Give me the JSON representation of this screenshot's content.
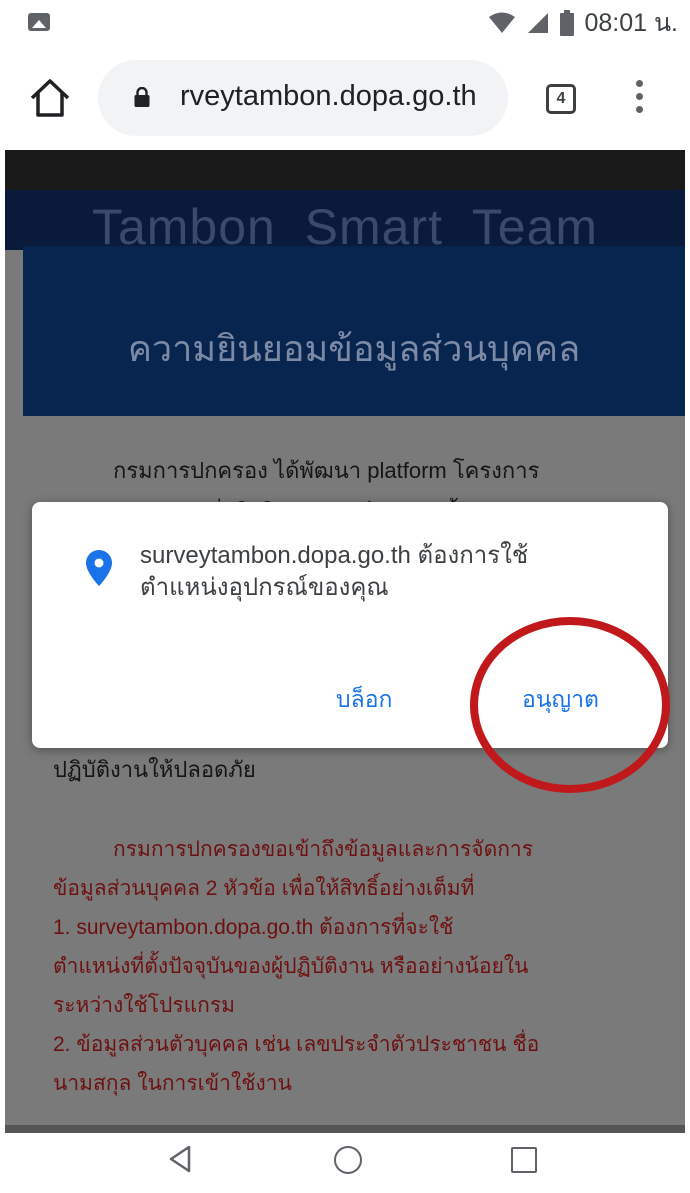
{
  "status_bar": {
    "time": "08:01 น.",
    "icons": [
      "image-notification-icon",
      "wifi-icon",
      "signal-icon",
      "battery-icon"
    ]
  },
  "browser": {
    "url": "rveytambon.dopa.go.th",
    "tab_count": "4"
  },
  "page": {
    "brand": "Tambon_Smart_Team",
    "consent_title": "ความยินยอมข้อมูลส่วนบุคคล",
    "intro_text": "กรมการปกครอง ได้พัฒนา platform โครงการ",
    "clipped_line": "ตำบลบรรจุการ เพื่อใช้ในการจัดเก็บข้อมูลพื้นฐานของ",
    "safe_line": "ปฏิบัติงานให้ปลอดภัย",
    "red_lines": [
      "กรมการปกครองขอเข้าถึงข้อมูลและการจัดการ",
      "ข้อมูลส่วนบุคคล 2 หัวข้อ เพื่อให้สิทธิ์อย่างเต็มที่",
      "1.    surveytambon.dopa.go.th ต้องการที่จะใช้",
      "ตำแหน่งที่ตั้งปัจจุบันของผู้ปฏิบัติงาน หรืออย่างน้อยใน",
      "ระหว่างใช้โปรแกรม",
      "2.    ข้อมูลส่วนตัวบุคคล เช่น เลขประจำตัวประชาชน ชื่อ",
      "นามสกุล ในการเข้าใช้งาน"
    ]
  },
  "permission_dialog": {
    "message_line1": "surveytambon.dopa.go.th ต้องการใช้",
    "message_line2": "ตำแหน่งอุปกรณ์ของคุณ",
    "block_label": "บล็อก",
    "allow_label": "อนุญาต"
  },
  "colors": {
    "accent": "#1a73e8",
    "annotation_circle": "#c0181b",
    "header_navy": "#082550"
  }
}
